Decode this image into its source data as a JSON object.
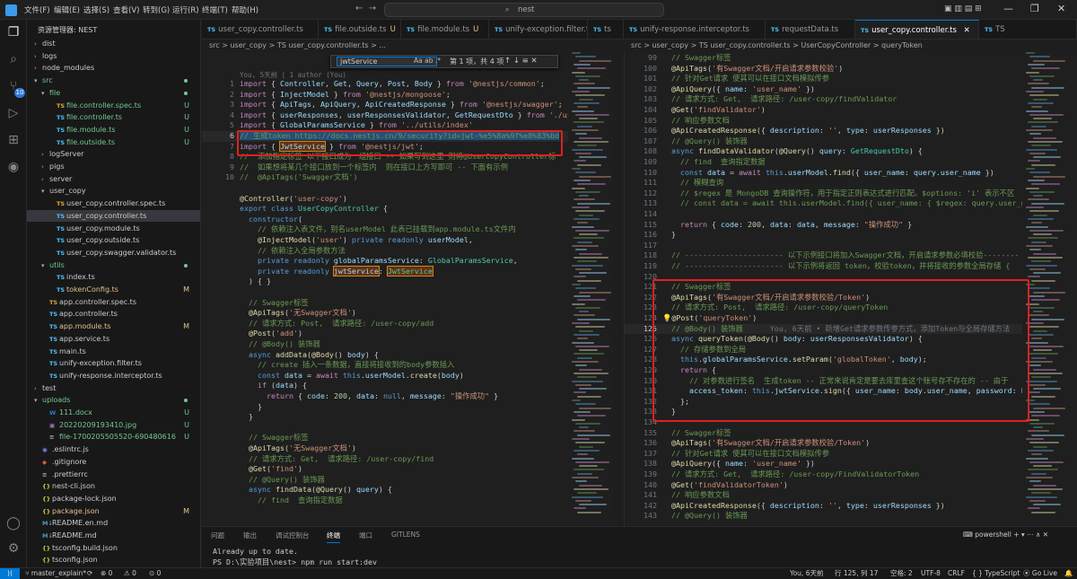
{
  "menu": [
    "文件(F)",
    "编辑(E)",
    "选择(S)",
    "查看(V)",
    "转到(G)",
    "运行(R)",
    "终端(T)",
    "帮助(H)"
  ],
  "search": {
    "text": "nest"
  },
  "sidebar": {
    "title": "资源管理器: NEST",
    "items": [
      {
        "label": "dist",
        "type": "folder",
        "indent": 1,
        "open": false,
        "status": ""
      },
      {
        "label": "logs",
        "type": "folder",
        "indent": 1,
        "open": false,
        "status": ""
      },
      {
        "label": "node_modules",
        "type": "folder",
        "indent": 1,
        "open": false,
        "status": ""
      },
      {
        "label": "src",
        "type": "folder",
        "indent": 1,
        "open": true,
        "status": "dot"
      },
      {
        "label": "file",
        "type": "folder",
        "indent": 2,
        "open": true,
        "status": "dot"
      },
      {
        "label": "file.controller.spec.ts",
        "type": "spec",
        "indent": 3,
        "status": "U"
      },
      {
        "label": "file.controller.ts",
        "type": "ts",
        "indent": 3,
        "status": "U"
      },
      {
        "label": "file.module.ts",
        "type": "ts",
        "indent": 3,
        "status": "U"
      },
      {
        "label": "file.outside.ts",
        "type": "ts",
        "indent": 3,
        "status": "U"
      },
      {
        "label": "logServer",
        "type": "folder",
        "indent": 2,
        "open": false,
        "status": ""
      },
      {
        "label": "pigs",
        "type": "folder",
        "indent": 2,
        "open": false,
        "status": ""
      },
      {
        "label": "server",
        "type": "folder",
        "indent": 2,
        "open": false,
        "status": ""
      },
      {
        "label": "user_copy",
        "type": "folder",
        "indent": 2,
        "open": true,
        "status": ""
      },
      {
        "label": "user_copy.controller.spec.ts",
        "type": "spec",
        "indent": 3,
        "status": ""
      },
      {
        "label": "user_copy.controller.ts",
        "type": "ts",
        "indent": 3,
        "status": "",
        "active": true
      },
      {
        "label": "user_copy.module.ts",
        "type": "ts",
        "indent": 3,
        "status": ""
      },
      {
        "label": "user_copy.outside.ts",
        "type": "ts",
        "indent": 3,
        "status": ""
      },
      {
        "label": "user_copy.swagger.validator.ts",
        "type": "ts",
        "indent": 3,
        "status": ""
      },
      {
        "label": "utils",
        "type": "folder",
        "indent": 2,
        "open": true,
        "status": "dot"
      },
      {
        "label": "index.ts",
        "type": "ts",
        "indent": 3,
        "status": ""
      },
      {
        "label": "tokenConfig.ts",
        "type": "ts",
        "indent": 3,
        "status": "M"
      },
      {
        "label": "app.controller.spec.ts",
        "type": "spec",
        "indent": 2,
        "status": ""
      },
      {
        "label": "app.controller.ts",
        "type": "ts",
        "indent": 2,
        "status": ""
      },
      {
        "label": "app.module.ts",
        "type": "ts",
        "indent": 2,
        "status": "M"
      },
      {
        "label": "app.service.ts",
        "type": "ts",
        "indent": 2,
        "status": ""
      },
      {
        "label": "main.ts",
        "type": "ts",
        "indent": 2,
        "status": ""
      },
      {
        "label": "unify-exception.filter.ts",
        "type": "ts",
        "indent": 2,
        "status": ""
      },
      {
        "label": "unify-response.interceptor.ts",
        "type": "ts",
        "indent": 2,
        "status": ""
      },
      {
        "label": "test",
        "type": "folder",
        "indent": 1,
        "open": false,
        "status": ""
      },
      {
        "label": "uploads",
        "type": "folder",
        "indent": 1,
        "open": true,
        "status": "dot"
      },
      {
        "label": "111.docx",
        "type": "doc",
        "indent": 2,
        "status": "U"
      },
      {
        "label": "20220209193410.jpg",
        "type": "img",
        "indent": 2,
        "status": "U"
      },
      {
        "label": "file-1700205505520-690480616",
        "type": "file",
        "indent": 2,
        "status": "U"
      },
      {
        "label": ".eslintrc.js",
        "type": "eslint",
        "indent": 1,
        "status": ""
      },
      {
        "label": ".gitignore",
        "type": "git",
        "indent": 1,
        "status": ""
      },
      {
        "label": ".prettierrc",
        "type": "cfg",
        "indent": 1,
        "status": ""
      },
      {
        "label": "nest-cli.json",
        "type": "json",
        "indent": 1,
        "status": ""
      },
      {
        "label": "package-lock.json",
        "type": "json",
        "indent": 1,
        "status": ""
      },
      {
        "label": "package.json",
        "type": "json",
        "indent": 1,
        "status": "M"
      },
      {
        "label": "README.en.md",
        "type": "md",
        "indent": 1,
        "status": ""
      },
      {
        "label": "README.md",
        "type": "md",
        "indent": 1,
        "status": ""
      },
      {
        "label": "tsconfig.build.json",
        "type": "json",
        "indent": 1,
        "status": ""
      },
      {
        "label": "tsconfig.json",
        "type": "json",
        "indent": 1,
        "status": ""
      }
    ]
  },
  "tabs_left": [
    {
      "label": "user_copy.controller.ts",
      "status": "",
      "active": false
    },
    {
      "label": "file.outside.ts",
      "status": "U",
      "active": false
    },
    {
      "label": "file.module.ts",
      "status": "U",
      "active": false
    },
    {
      "label": "unify-exception.filter.ts",
      "status": "",
      "active": false
    },
    {
      "label": "ts",
      "status": "",
      "active": false
    }
  ],
  "tabs_right": [
    {
      "label": "unify-response.interceptor.ts",
      "status": "",
      "active": false
    },
    {
      "label": "requestData.ts",
      "status": "",
      "active": false
    },
    {
      "label": "user_copy.controller.ts",
      "status": "",
      "active": true
    },
    {
      "label": "TS",
      "status": "",
      "active": false
    }
  ],
  "breadcrumb_left": "src > user_copy > TS user_copy.controller.ts > ...",
  "breadcrumb_right": "src > user_copy > TS user_copy.controller.ts > UserCopyController > queryToken",
  "find": {
    "value": "jwtService",
    "options": "Aa ab .*",
    "count": "第 1 项，共 4 项"
  },
  "blame_left": "You, 5天前 | 1 author (You)",
  "editor_left": [
    {
      "n": "1",
      "h": "<span class='k'>import</span> { <span class='v'>Controller</span>, <span class='v'>Get</span>, <span class='v'>Query</span>, <span class='v'>Post</span>, <span class='v'>Body</span> } <span class='k'>from</span> <span class='s'>'@nestjs/common'</span>;"
    },
    {
      "n": "2",
      "h": "<span class='k'>import</span> { <span class='v'>InjectModel</span> } <span class='k'>from</span> <span class='s'>'@nestjs/mongoose'</span>;"
    },
    {
      "n": "3",
      "h": "<span class='k'>import</span> { <span class='v'>ApiTags</span>, <span class='v'>ApiQuery</span>, <span class='v'>ApiCreatedResponse</span> } <span class='k'>from</span> <span class='s'>'@nestjs/swagger'</span>;"
    },
    {
      "n": "4",
      "h": "<span class='k'>import</span> { <span class='v'>userResponses</span>, <span class='v'>userResponsesValidator</span>, <span class='v'>GetRequestDto</span> } <span class='k'>from</span> <span class='s'>'./user</span>"
    },
    {
      "n": "5",
      "h": "<span class='k'>import</span> { <span class='v'>GlobalParamsService</span> } <span class='k'>from</span> <span class='s'>'../utils/index'</span>"
    },
    {
      "n": "6",
      "h": "<span class='c sel'>// 生成token https://docs.nestjs.cn/9/security?id=jwt-%e5%8a%9f%e8%83%bd</span>",
      "cur": true
    },
    {
      "n": "7",
      "h": "<span class='k'>import</span> { <span class='fnd v'>JwtService</span> } <span class='k'>from</span> <span class='s'>'@nestjs/jwt'</span>;"
    },
    {
      "n": "8",
      "h": "<span class='c'>//  添加指定标签 以下接口成为一组接口 -- 如果写到这里 则将@UserCopyController标</span>"
    },
    {
      "n": "9",
      "h": "<span class='c'>//  如果想将某几个接口放到一个标签内  则在接口上方写即可 -- 下面有示例</span>"
    },
    {
      "n": "10",
      "h": "<span class='c'>//  @ApiTags('Swagger文档')</span>"
    },
    {
      "n": "",
      "h": ""
    },
    {
      "n": "",
      "h": "<span class='f'>@Controller</span>(<span class='s'>'user-copy'</span>)"
    },
    {
      "n": "",
      "h": "<span class='b'>export</span> <span class='b'>class</span> <span class='t'>UserCopyController</span> {"
    },
    {
      "n": "",
      "h": "  <span class='b'>constructor</span>("
    },
    {
      "n": "",
      "h": "    <span class='c'>// 依赖注入表文件，别名userModel 此表已挂载到app.module.ts文件内</span>"
    },
    {
      "n": "",
      "h": "    <span class='f'>@InjectModel</span>(<span class='s'>'user'</span>) <span class='b'>private</span> <span class='b'>readonly</span> <span class='v'>userModel</span>,"
    },
    {
      "n": "",
      "h": "    <span class='c'>// 依赖注入全局参数方法</span>"
    },
    {
      "n": "",
      "h": "    <span class='b'>private</span> <span class='b'>readonly</span> <span class='v'>globalParamsService</span>: <span class='t'>GlobalParamsService</span>,"
    },
    {
      "n": "",
      "h": "    <span class='b'>private</span> <span class='b'>readonly</span> <span class='fnd v'>jwtService</span>: <span class='fnd t'>JwtService</span>"
    },
    {
      "n": "",
      "h": "  ) { }"
    },
    {
      "n": "",
      "h": ""
    },
    {
      "n": "",
      "h": "  <span class='c'>// Swagger标签</span>"
    },
    {
      "n": "",
      "h": "  <span class='f'>@ApiTags</span>(<span class='s'>'无Swagger文档'</span>)"
    },
    {
      "n": "",
      "h": "  <span class='c'>// 请求方式: Post,  请求路径: /user-copy/add</span>"
    },
    {
      "n": "",
      "h": "  <span class='f'>@Post</span>(<span class='s'>'add'</span>)"
    },
    {
      "n": "",
      "h": "  <span class='c'>// @Body() 装饰器</span>"
    },
    {
      "n": "",
      "h": "  <span class='b'>async</span> <span class='f'>addData</span>(<span class='f'>@Body</span>() <span class='v'>body</span>) {"
    },
    {
      "n": "",
      "h": "    <span class='c'>// create 插入一条数据，直接将接收到的body参数插入</span>"
    },
    {
      "n": "",
      "h": "    <span class='b'>const</span> <span class='v'>data</span> = <span class='k'>await</span> <span class='b'>this</span>.<span class='v'>userModel</span>.<span class='f'>create</span>(<span class='v'>body</span>)"
    },
    {
      "n": "",
      "h": "    <span class='k'>if</span> (<span class='v'>data</span>) {"
    },
    {
      "n": "",
      "h": "      <span class='k'>return</span> { <span class='v'>code</span>: <span class='n'>200</span>, <span class='v'>data</span>: <span class='b'>null</span>, <span class='v'>message</span>: <span class='s'>\"操作成功\"</span> }"
    },
    {
      "n": "",
      "h": "    }"
    },
    {
      "n": "",
      "h": "  }"
    },
    {
      "n": "",
      "h": ""
    },
    {
      "n": "",
      "h": "  <span class='c'>// Swagger标签</span>"
    },
    {
      "n": "",
      "h": "  <span class='f'>@ApiTags</span>(<span class='s'>'无Swagger文档'</span>)"
    },
    {
      "n": "",
      "h": "  <span class='c'>// 请求方式: Get,  请求路径: /user-copy/find</span>"
    },
    {
      "n": "",
      "h": "  <span class='f'>@Get</span>(<span class='s'>'find'</span>)"
    },
    {
      "n": "",
      "h": "  <span class='c'>// @Query() 装饰器</span>"
    },
    {
      "n": "",
      "h": "  <span class='b'>async</span> <span class='f'>findData</span>(<span class='f'>@Query</span>() <span class='v'>query</span>) {"
    },
    {
      "n": "",
      "h": "    <span class='c'>// find  查询指定数据</span>"
    }
  ],
  "editor_right": [
    {
      "n": "99",
      "h": "  <span class='c'>// Swagger标签</span>"
    },
    {
      "n": "100",
      "h": "  <span class='f'>@ApiTags</span>(<span class='s'>'有Swagger文档/开启请求参数校验'</span>)"
    },
    {
      "n": "101",
      "h": "  <span class='c'>// 针对Get请求 使其可以在接口文档模拟传参</span>"
    },
    {
      "n": "102",
      "h": "  <span class='f'>@ApiQuery</span>({ <span class='v'>name</span>: <span class='s'>'user_name'</span> })"
    },
    {
      "n": "103",
      "h": "  <span class='c'>// 请求方式: Get,  请求路径: /user-copy/findValidator</span>"
    },
    {
      "n": "104",
      "h": "  <span class='f'>@Get</span>(<span class='s'>'findValidator'</span>)"
    },
    {
      "n": "105",
      "h": "  <span class='c'>// 响应参数文档</span>"
    },
    {
      "n": "106",
      "h": "  <span class='f'>@ApiCreatedResponse</span>({ <span class='v'>description</span>: <span class='s'>''</span>, <span class='v'>type</span>: <span class='v'>userResponses</span> })"
    },
    {
      "n": "107",
      "h": "  <span class='c'>// @Query() 装饰器</span>"
    },
    {
      "n": "108",
      "h": "  <span class='b'>async</span> <span class='f'>findDataValidator</span>(<span class='f'>@Query</span>() <span class='v'>query</span>: <span class='t'>GetRequestDto</span>) {"
    },
    {
      "n": "109",
      "h": "    <span class='c'>// find  查询指定数据</span>"
    },
    {
      "n": "110",
      "h": "    <span class='b'>const</span> <span class='v'>data</span> = <span class='k'>await</span> <span class='b'>this</span>.<span class='v'>userModel</span>.<span class='f'>find</span>({ <span class='v'>user_name</span>: <span class='v'>query</span>.<span class='v'>user_name</span> })"
    },
    {
      "n": "111",
      "h": "    <span class='c'>// 模糊查询</span>"
    },
    {
      "n": "112",
      "h": "    <span class='c'>// $regex 是 MongoDB 查询操作符，用于指定正则表达式进行匹配。$options: 'i' 表示不区</span>"
    },
    {
      "n": "113",
      "h": "    <span class='c'>// const data = await this.userModel.find({ user_name: { $regex: query.user_nam</span>"
    },
    {
      "n": "114",
      "h": ""
    },
    {
      "n": "115",
      "h": "    <span class='k'>return</span> { <span class='v'>code</span>: <span class='n'>200</span>, <span class='v'>data</span>: <span class='v'>data</span>, <span class='v'>message</span>: <span class='s'>\"操作成功\"</span> }"
    },
    {
      "n": "116",
      "h": "  }"
    },
    {
      "n": "117",
      "h": ""
    },
    {
      "n": "118",
      "h": "  <span class='c'>// ---------------------- 以下示例接口将加入Swagger文档，开启请求参数必填校验--------</span>"
    },
    {
      "n": "119",
      "h": "  <span class='c'>// ---------------------- 以下示例将返回 token，校验token，并将接收的参数全局存储 {</span>"
    },
    {
      "n": "120",
      "h": ""
    },
    {
      "n": "121",
      "h": "  <span class='c'>// Swagger标签</span>"
    },
    {
      "n": "122",
      "h": "  <span class='f'>@ApiTags</span>(<span class='s'>'有Swagger文档/开启请求参数校验/Token'</span>)"
    },
    {
      "n": "123",
      "h": "  <span class='c'>// 请求方式: Post,  请求路径: /user-copy/queryToken</span>"
    },
    {
      "n": "124",
      "h": "<span class='y'>💡</span><span class='f'>@Post</span>(<span class='s'>'queryToken'</span>)"
    },
    {
      "n": "125",
      "h": "  <span class='c'>// @Body() 装饰器</span>      <span style='color:#6e7681'>You, 6天前 • 新增Get请求参数传参方式，添加Token与全局存储方法</span>",
      "cur": true
    },
    {
      "n": "126",
      "h": "  <span class='b'>async</span> <span class='f'>queryToken</span>(<span class='f'>@Body</span>() <span class='v'>body</span>: <span class='v'>userResponsesValidator</span>) {"
    },
    {
      "n": "127",
      "h": "    <span class='c'>// 存储参数到全局</span>"
    },
    {
      "n": "128",
      "h": "    <span class='b'>this</span>.<span class='v'>globalParamsService</span>.<span class='f'>setParam</span>(<span class='s'>'globalToken'</span>, <span class='v'>body</span>);"
    },
    {
      "n": "129",
      "h": "    <span class='k'>return</span> {"
    },
    {
      "n": "130",
      "h": "      <span class='c'>// 对参数进行签名  生成token -- 正常来说肯定是要去库里查这个账号存不存在的 -- 由于</span>"
    },
    {
      "n": "131",
      "h": "      <span class='v'>access_token</span>: <span class='b'>this</span>.<span class='v'>jwtService</span>.<span class='f'>sign</span>({ <span class='v'>user_name</span>: <span class='v'>body</span>.<span class='v'>user_name</span>, <span class='v'>password</span>: <span class='v'>bod</span>"
    },
    {
      "n": "132",
      "h": "    };"
    },
    {
      "n": "133",
      "h": "  }"
    },
    {
      "n": "134",
      "h": ""
    },
    {
      "n": "135",
      "h": "  <span class='c'>// Swagger标签</span>"
    },
    {
      "n": "136",
      "h": "  <span class='f'>@ApiTags</span>(<span class='s'>'有Swagger文档/开启请求参数校验/Token'</span>)"
    },
    {
      "n": "137",
      "h": "  <span class='c'>// 针对Get请求 使其可以在接口文档模拟传参</span>"
    },
    {
      "n": "138",
      "h": "  <span class='f'>@ApiQuery</span>({ <span class='v'>name</span>: <span class='s'>'user_name'</span> })"
    },
    {
      "n": "139",
      "h": "  <span class='c'>// 请求方式: Get,  请求路径: /user-copy/FindValidatorToken</span>"
    },
    {
      "n": "140",
      "h": "  <span class='f'>@Get</span>(<span class='s'>'findValidatorToken'</span>)"
    },
    {
      "n": "141",
      "h": "  <span class='c'>// 响应参数文档</span>"
    },
    {
      "n": "142",
      "h": "  <span class='f'>@ApiCreatedResponse</span>({ <span class='v'>description</span>: <span class='s'>''</span>, <span class='v'>type</span>: <span class='v'>userResponses</span> })"
    },
    {
      "n": "143",
      "h": "  <span class='c'>// @Query() 装饰器</span>"
    }
  ],
  "panel": {
    "tabs": [
      "问题",
      "输出",
      "调试控制台",
      "终端",
      "端口",
      "GITLENS"
    ],
    "active": 3,
    "terminal_label": "powershell",
    "terminal_lines": [
      "Already up to date.",
      "PS D:\\实验项目\\nest> npm run start:dev"
    ]
  },
  "status": {
    "branch": "master_explain*",
    "sync": "⟳",
    "errors": "⊗ 0",
    "warnings": "⚠ 0",
    "ports": "⊙ 0",
    "blame": "You, 6天前",
    "position": "行 125, 列 17",
    "spaces": "空格: 2",
    "encoding": "UTF-8",
    "eol": "CRLF",
    "lang": "{ } TypeScript",
    "golive": "Go Live"
  }
}
